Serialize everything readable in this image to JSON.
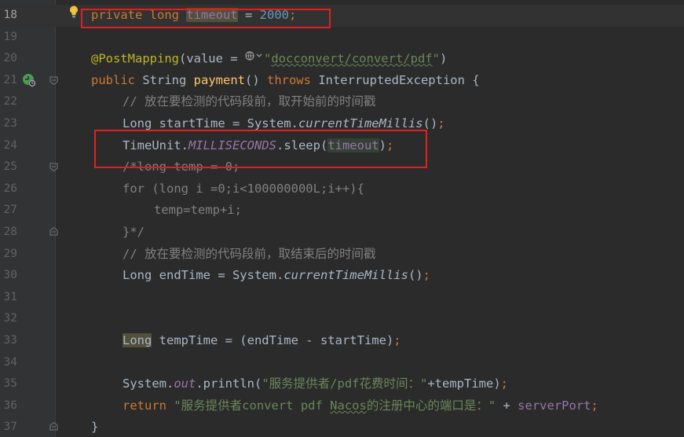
{
  "editor": {
    "lines": [
      {
        "num": "18",
        "current": true
      },
      {
        "num": "19"
      },
      {
        "num": "20"
      },
      {
        "num": "21"
      },
      {
        "num": "22"
      },
      {
        "num": "23"
      },
      {
        "num": "24"
      },
      {
        "num": "25"
      },
      {
        "num": "26"
      },
      {
        "num": "27"
      },
      {
        "num": "28"
      },
      {
        "num": "29"
      },
      {
        "num": "30"
      },
      {
        "num": "31"
      },
      {
        "num": "32"
      },
      {
        "num": "33"
      },
      {
        "num": "34"
      },
      {
        "num": "35"
      },
      {
        "num": "36"
      },
      {
        "num": "37"
      }
    ],
    "tokens": {
      "l18_private": "private",
      "l18_long": "long",
      "l18_timeout": "timeout",
      "l18_eq": " = ",
      "l18_value": "2000",
      "l18_semi": ";",
      "l20_ann": "@PostMapping",
      "l20_open": "(value = ",
      "l20_str_q": "\"",
      "l20_str": "docconvert/convert/pdf",
      "l20_str_q2": "\"",
      "l20_close": ")",
      "l21_public": "public",
      "l21_type": " String ",
      "l21_name": "payment",
      "l21_parens": "() ",
      "l21_throws": "throws",
      "l21_exc": " InterruptedException {",
      "l22_comment": "// 放在要检测的代码段前，取开始前的时间戳",
      "l23_a": "Long startTime = System.",
      "l23_b": "currentTimeMillis",
      "l23_c": "()",
      "l23_semi": ";",
      "l24_a": "TimeUnit.",
      "l24_b": "MILLISECONDS",
      "l24_c": ".sleep(",
      "l24_d": "timeout",
      "l24_e": ")",
      "l24_semi": ";",
      "l25": "/*long temp = 0;",
      "l26": "for (long i =0;i<100000000L;i++){",
      "l27": "temp=temp+i;",
      "l28": "}*/",
      "l29_comment": "// 放在要检测的代码段前，取结束后的时间戳",
      "l30_a": "Long endTime = System.",
      "l30_b": "currentTimeMillis",
      "l30_c": "()",
      "l30_semi": ";",
      "l33_a": "Long",
      "l33_b": " tempTime = (endTime - startTime)",
      "l33_semi": ";",
      "l35_a": "System.",
      "l35_b": "out",
      "l35_c": ".println(",
      "l35_str": "\"服务提供者/pdf花费时间：\"",
      "l35_d": "+tempTime)",
      "l35_semi": ";",
      "l36_return": "return ",
      "l36_str1": "\"服务提供者convert pdf ",
      "l36_nacos": "Nacos",
      "l36_str2": "的注册中心的端口是：\"",
      "l36_plus": " + ",
      "l36_port": "serverPort",
      "l36_semi": ";",
      "l37": "}"
    }
  },
  "colors": {
    "background": "#2b2b2b",
    "keyword": "#cc7832",
    "annotation": "#bbb529",
    "string": "#6a8759",
    "number": "#6897bb",
    "comment": "#808080",
    "field": "#9876aa",
    "method": "#ffc66d",
    "highlight_box": "#e0201e"
  },
  "icons": [
    "intention-bulb-icon",
    "run-gutter-icon",
    "fold-icon",
    "globe-hint-icon"
  ]
}
